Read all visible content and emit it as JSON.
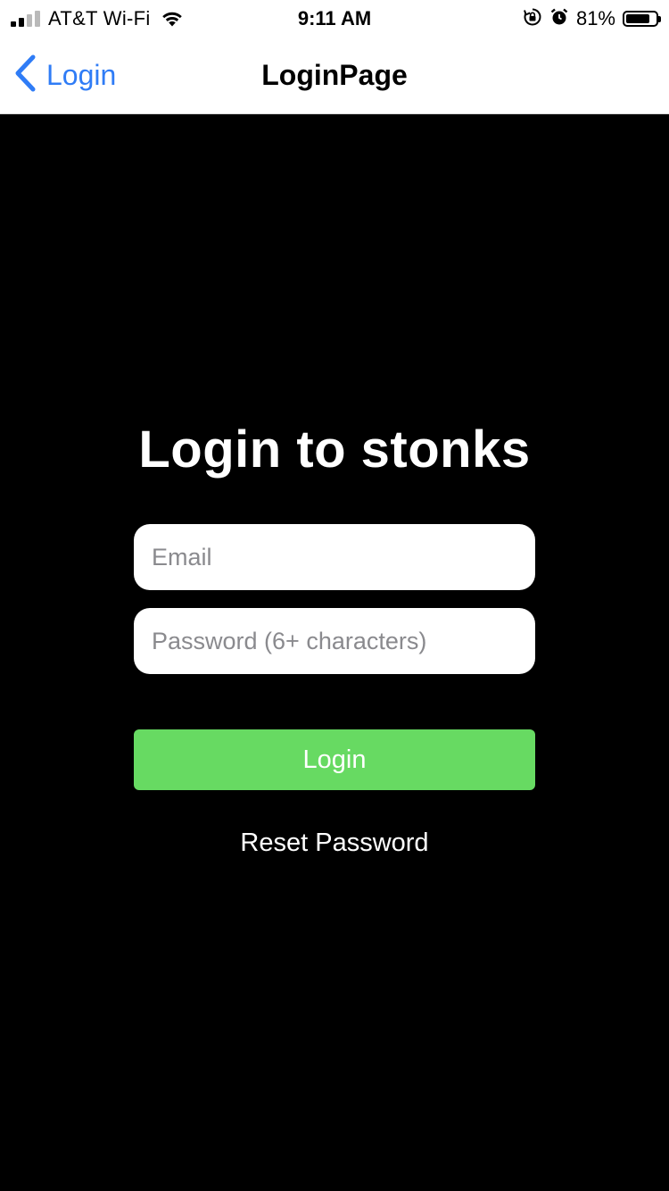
{
  "status_bar": {
    "carrier": "AT&T Wi-Fi",
    "time": "9:11 AM",
    "battery_percent": "81%",
    "battery_level": 0.81,
    "signal_bars": 2,
    "icons": [
      "signal-icon",
      "wifi-icon",
      "orientation-lock-icon",
      "alarm-icon",
      "battery-icon"
    ]
  },
  "nav": {
    "back_label": "Login",
    "title": "LoginPage",
    "back_icon": "chevron-left-icon"
  },
  "form": {
    "heading": "Login to stonks",
    "email_placeholder": "Email",
    "email_value": "",
    "password_placeholder": "Password (6+ characters)",
    "password_value": "",
    "login_label": "Login",
    "reset_label": "Reset Password"
  },
  "colors": {
    "background": "#000000",
    "nav_background": "#ffffff",
    "accent_blue": "#2f7cf6",
    "button_green": "#67da62"
  }
}
